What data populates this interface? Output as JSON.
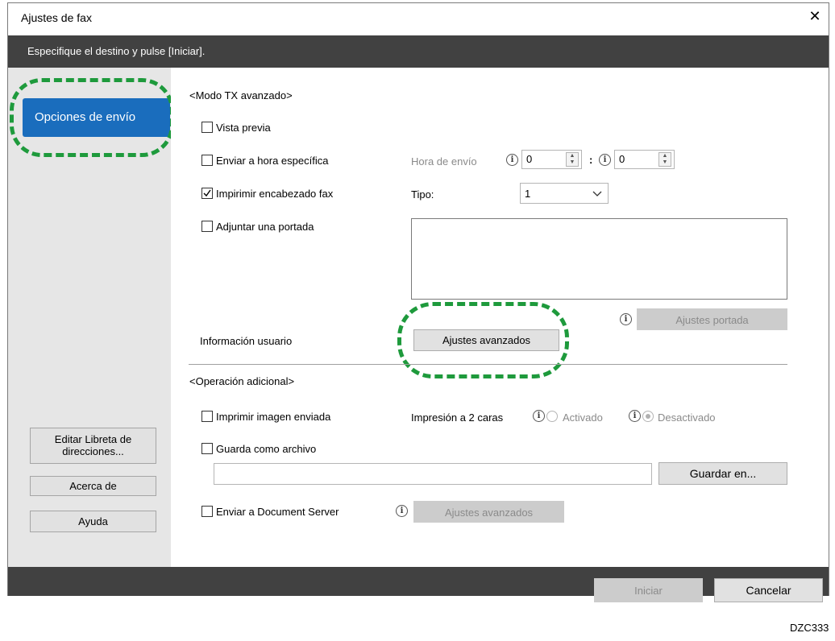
{
  "window": {
    "title": "Ajustes de fax",
    "close_icon": "close-icon",
    "instruction": "Especifique el destino y pulse [Iniciar]."
  },
  "sidebar": {
    "selected": "Opciones de envío",
    "edit_address_book_line1": "Editar Libreta de",
    "edit_address_book_line2": "direcciones...",
    "about": "Acerca de",
    "help": "Ayuda"
  },
  "advanced_tx": {
    "heading": "<Modo TX avanzado>",
    "preview": {
      "label": "Vista previa",
      "checked": false
    },
    "send_at_time": {
      "label": "Enviar a hora específica",
      "checked": false
    },
    "send_time_label": "Hora de envío",
    "hour_value": "0",
    "minute_value": "0",
    "time_separator": ":",
    "print_header": {
      "label": "Impirimir encabezado fax",
      "checked": true
    },
    "type_label": "Tipo:",
    "type_value": "1",
    "cover_page": {
      "label": "Adjuntar una portada",
      "checked": false
    },
    "cover_settings_button": "Ajustes portada",
    "user_info_label": "Información usuario",
    "advanced_settings_button": "Ajustes avanzados"
  },
  "additional_op": {
    "heading": "<Operación adicional>",
    "print_sent_image": {
      "label": "Imprimir imagen enviada",
      "checked": false
    },
    "duplex_label": "Impresión a 2 caras",
    "on_label": "Activado",
    "off_label": "Desactivado",
    "save_as_file": {
      "label": "Guarda como archivo",
      "checked": false
    },
    "file_path_value": "",
    "save_to_button": "Guardar en...",
    "send_doc_server": {
      "label": "Enviar a Document Server",
      "checked": false
    },
    "doc_server_settings_button": "Ajustes avanzados"
  },
  "footer": {
    "start_button": "Iniciar",
    "cancel_button": "Cancelar"
  },
  "figure_code": "DZC333",
  "colors": {
    "accent_blue": "#1a6dbd",
    "dark_bar": "#414141",
    "highlight_green": "#1e9a3c"
  },
  "icons": {
    "info": "info-icon",
    "spin_up": "spin-up-icon",
    "spin_down": "spin-down-icon",
    "dropdown": "chevron-down-icon",
    "check": "checkmark-icon"
  }
}
